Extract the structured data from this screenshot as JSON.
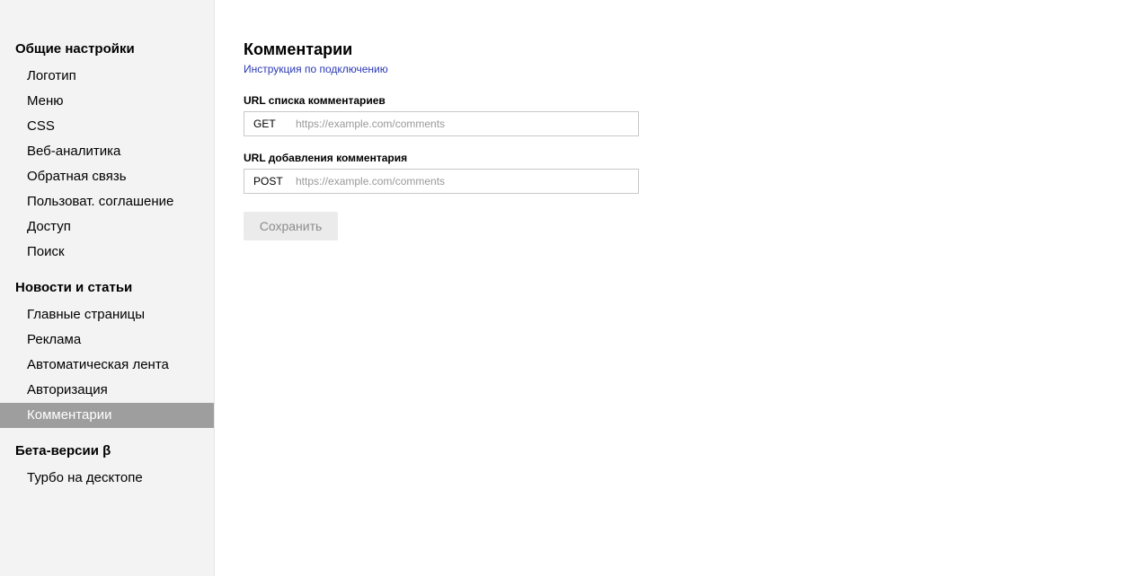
{
  "sidebar": {
    "groups": [
      {
        "title": "Общие настройки",
        "items": [
          "Логотип",
          "Меню",
          "CSS",
          "Веб-аналитика",
          "Обратная связь",
          "Пользоват. соглашение",
          "Доступ",
          "Поиск"
        ]
      },
      {
        "title": "Новости и статьи",
        "items": [
          "Главные страницы",
          "Реклама",
          "Автоматическая лента",
          "Авторизация",
          "Комментарии"
        ]
      },
      {
        "title": "Бета-версии β",
        "items": [
          "Турбо на десктопе"
        ]
      }
    ],
    "active_item": "Комментарии"
  },
  "main": {
    "title": "Комментарии",
    "help_link": "Инструкция по подключению",
    "fields": [
      {
        "label": "URL списка комментариев",
        "method": "GET",
        "value": "",
        "placeholder": "https://example.com/comments"
      },
      {
        "label": "URL добавления комментария",
        "method": "POST",
        "value": "",
        "placeholder": "https://example.com/comments"
      }
    ],
    "save_label": "Сохранить"
  },
  "colors": {
    "sidebar_bg": "#f3f3f3",
    "active_bg": "#9e9e9e",
    "link": "#2a38b5",
    "button_bg": "#ebebeb",
    "button_text": "#8c8c8c"
  }
}
